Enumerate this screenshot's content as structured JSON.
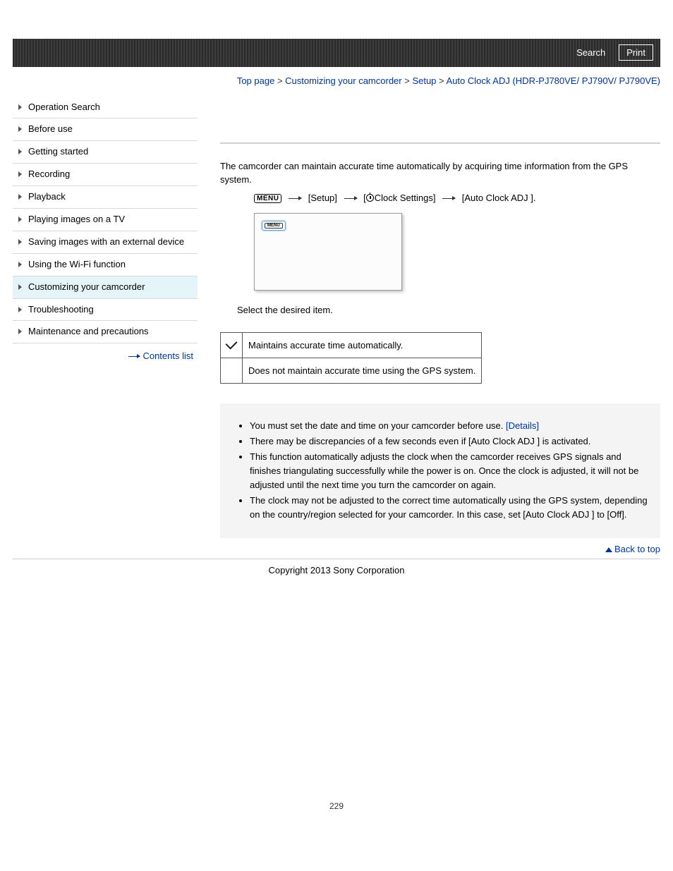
{
  "banner": {
    "search": "Search",
    "print": "Print"
  },
  "breadcrumb": {
    "top": "Top page",
    "section": "Customizing your camcorder",
    "sub": "Setup",
    "current": "Auto Clock ADJ (HDR-PJ780VE/ PJ790V/ PJ790VE)",
    "sep": " > "
  },
  "nav": {
    "items": [
      "Operation Search",
      "Before use",
      "Getting started",
      "Recording",
      "Playback",
      "Playing images on a TV",
      "Saving images with an external device",
      "Using the Wi-Fi function",
      "Customizing your camcorder",
      "Troubleshooting",
      "Maintenance and precautions"
    ],
    "active_index": 8,
    "contents_list": "Contents list"
  },
  "content": {
    "intro": "The camcorder can maintain accurate time automatically by acquiring time information from the GPS system.",
    "menu_label": "MENU",
    "path_setup": " [Setup] ",
    "path_clock": "Clock Settings] ",
    "path_item": " [Auto Clock ADJ ].",
    "bracket_open": " [",
    "mini_menu": "MENU",
    "instruction": "Select the desired item.",
    "table": {
      "row1": "Maintains accurate time automatically.",
      "row2": "Does not maintain accurate time using the GPS system."
    },
    "notes": {
      "n1_pre": "You must set the date and time on your camcorder before use. ",
      "n1_link": "[Details]",
      "n2": "There may be discrepancies of a few seconds even if [Auto Clock ADJ ] is activated.",
      "n3": "This function automatically adjusts the clock when the camcorder receives GPS signals and finishes triangulating successfully while the power is on. Once the clock is adjusted, it will not be adjusted until the next time you turn the camcorder on again.",
      "n4": "The clock may not be adjusted to the correct time automatically using the GPS system, depending on the country/region selected for your camcorder. In this case, set [Auto Clock ADJ ] to [Off]."
    },
    "back_to_top": "Back to top"
  },
  "footer": {
    "copyright": "Copyright 2013 Sony Corporation",
    "page_number": "229"
  }
}
